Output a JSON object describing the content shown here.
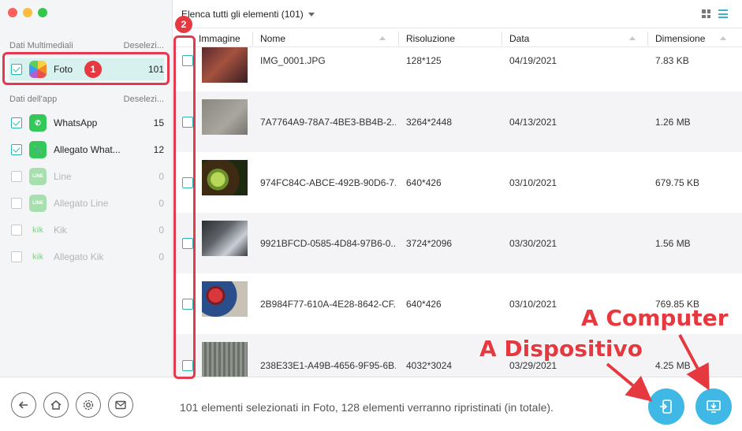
{
  "sidebar": {
    "media_section": {
      "title": "Dati Multimediali",
      "action": "Deselezi..."
    },
    "foto": {
      "label": "Foto",
      "count": "101"
    },
    "app_section": {
      "title": "Dati dell'app",
      "action": "Deselezi..."
    },
    "apps": [
      {
        "label": "WhatsApp",
        "count": "15",
        "checked": true
      },
      {
        "label": "Allegato What...",
        "count": "12",
        "checked": true
      },
      {
        "label": "Line",
        "count": "0",
        "checked": false
      },
      {
        "label": "Allegato Line",
        "count": "0",
        "checked": false
      },
      {
        "label": "Kik",
        "count": "0",
        "checked": false
      },
      {
        "label": "Allegato Kik",
        "count": "0",
        "checked": false
      }
    ]
  },
  "header": {
    "list_title": "Elenca tutti gli elementi (101)"
  },
  "table": {
    "columns": {
      "image": "Immagine",
      "name": "Nome",
      "resolution": "Risoluzione",
      "date": "Data",
      "size": "Dimensione"
    },
    "rows": [
      {
        "name": "IMG_0001.JPG",
        "resolution": "128*125",
        "date": "04/19/2021",
        "size": "7.83 KB"
      },
      {
        "name": "7A7764A9-78A7-4BE3-BB4B-2...",
        "resolution": "3264*2448",
        "date": "04/13/2021",
        "size": "1.26 MB"
      },
      {
        "name": "974FC84C-ABCE-492B-90D6-7...",
        "resolution": "640*426",
        "date": "03/10/2021",
        "size": "679.75 KB"
      },
      {
        "name": "9921BFCD-0585-4D84-97B6-0...",
        "resolution": "3724*2096",
        "date": "03/30/2021",
        "size": "1.56 MB"
      },
      {
        "name": "2B984F77-610A-4E28-8642-CF...",
        "resolution": "640*426",
        "date": "03/10/2021",
        "size": "769.85 KB"
      },
      {
        "name": "238E33E1-A49B-4656-9F95-6B...",
        "resolution": "4032*3024",
        "date": "03/29/2021",
        "size": "4.25 MB"
      }
    ]
  },
  "footer": {
    "status": "101 elementi selezionati in Foto, 128 elementi verranno ripristinati (in totale)."
  },
  "annotations": {
    "badge1": "1",
    "badge2": "2",
    "to_device": "A Dispositivo",
    "to_computer": "A Computer"
  },
  "colors": {
    "accent": "#2bb5b0",
    "highlight": "#e33a4f",
    "action": "#3fb8e6"
  }
}
